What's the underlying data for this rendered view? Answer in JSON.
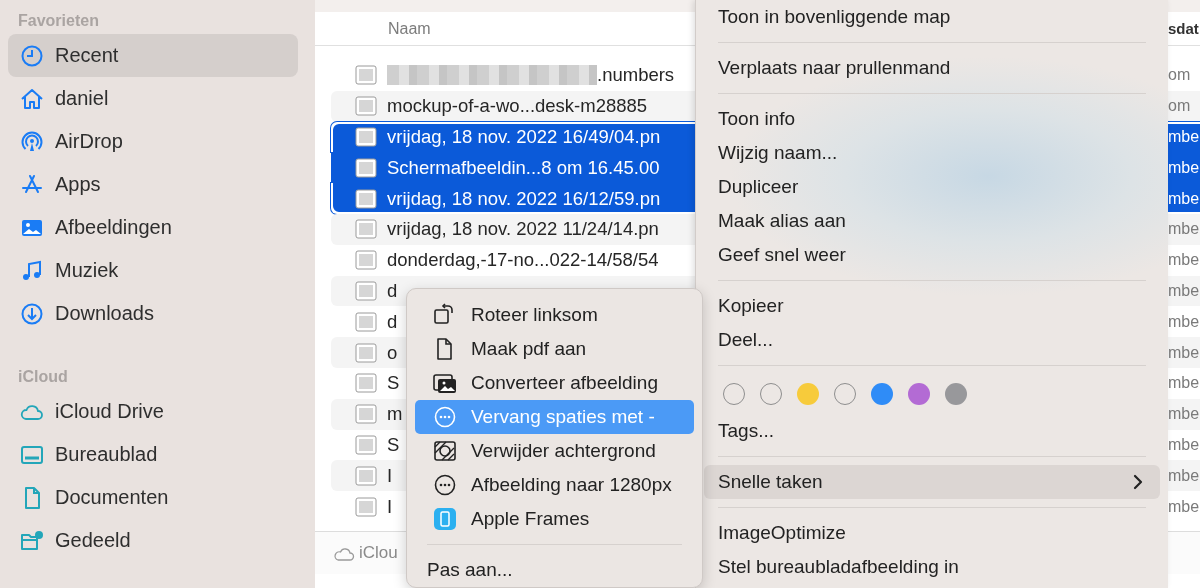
{
  "sidebar": {
    "sections": [
      {
        "title": "Favorieten",
        "items": [
          {
            "label": "Recent",
            "selected": true
          },
          {
            "label": "daniel",
            "selected": false
          },
          {
            "label": "AirDrop",
            "selected": false
          },
          {
            "label": "Apps",
            "selected": false
          },
          {
            "label": "Afbeeldingen",
            "selected": false
          },
          {
            "label": "Muziek",
            "selected": false
          },
          {
            "label": "Downloads",
            "selected": false
          }
        ]
      },
      {
        "title": "iCloud",
        "items": [
          {
            "label": "iCloud Drive",
            "selected": false
          },
          {
            "label": "Bureaublad",
            "selected": false
          },
          {
            "label": "Documenten",
            "selected": false
          },
          {
            "label": "Gedeeld",
            "selected": false
          }
        ]
      }
    ]
  },
  "table": {
    "columns": [
      {
        "label": "Naam"
      },
      {
        "label": "sdat"
      }
    ],
    "rows": [
      {
        "kind": "blurred",
        "name": ".numbers",
        "column_2": "om",
        "selected": false
      },
      {
        "kind": "plain",
        "name": "mockup-of-a-wo...desk-m28885",
        "column_2": "om",
        "selected": false
      },
      {
        "kind": "plain",
        "name": "vrijdag, 18 nov. 2022 16/49/04.pn",
        "column_2": "mbe",
        "selected": true
      },
      {
        "kind": "plain",
        "name": "Schermafbeeldin...8 om 16.45.00",
        "column_2": "mbe",
        "selected": true
      },
      {
        "kind": "plain",
        "name": "vrijdag, 18 nov. 2022 16/12/59.pn",
        "column_2": "mbe",
        "selected": true
      },
      {
        "kind": "plain",
        "name": "vrijdag, 18 nov. 2022 11/24/14.pn",
        "column_2": "mbe",
        "selected": false
      },
      {
        "kind": "plain",
        "name": "donderdag,-17-no...022-14/58/54",
        "column_2": "mbe",
        "selected": false
      },
      {
        "kind": "plain",
        "name": "d",
        "column_2": "mbe",
        "selected": false
      },
      {
        "kind": "plain",
        "name": "d",
        "column_2": "mbe",
        "selected": false
      },
      {
        "kind": "plain",
        "name": "o",
        "column_2": "mbe",
        "selected": false
      },
      {
        "kind": "plain",
        "name": "S",
        "column_2": "mbe",
        "selected": false
      },
      {
        "kind": "plain",
        "name": "m",
        "column_2": "mbe",
        "selected": false
      },
      {
        "kind": "plain",
        "name": "S",
        "column_2": "mbe",
        "selected": false
      },
      {
        "kind": "plain",
        "name": "I",
        "column_2": "mbe",
        "selected": false
      },
      {
        "kind": "plain",
        "name": "I",
        "column_2": "mbe",
        "selected": false
      }
    ]
  },
  "status_bar": {
    "label": "iClou"
  },
  "context_menu": {
    "items": [
      {
        "kind": "item",
        "label": "Toon in bovenliggende map"
      },
      {
        "kind": "separator"
      },
      {
        "kind": "item",
        "label": "Verplaats naar prullenmand"
      },
      {
        "kind": "separator"
      },
      {
        "kind": "item",
        "label": "Toon info"
      },
      {
        "kind": "item",
        "label": "Wijzig naam..."
      },
      {
        "kind": "item",
        "label": "Dupliceer"
      },
      {
        "kind": "item",
        "label": "Maak alias aan"
      },
      {
        "kind": "item",
        "label": "Geef snel weer"
      },
      {
        "kind": "separator"
      },
      {
        "kind": "item",
        "label": "Kopieer"
      },
      {
        "kind": "item",
        "label": "Deel..."
      },
      {
        "kind": "separator"
      },
      {
        "kind": "tags",
        "tags": [
          {
            "kind": "ring",
            "color": "#8e8e8e"
          },
          {
            "kind": "ring",
            "color": "#8e8e8e"
          },
          {
            "kind": "filled",
            "color": "#f7cb3b"
          },
          {
            "kind": "ring",
            "color": "#8e8e8e"
          },
          {
            "kind": "filled",
            "color": "#2f8cf7"
          },
          {
            "kind": "filled",
            "color": "#b36bd4"
          },
          {
            "kind": "filled",
            "color": "#98989b"
          }
        ]
      },
      {
        "kind": "item",
        "label": "Tags..."
      },
      {
        "kind": "separator"
      },
      {
        "kind": "submenu",
        "label": "Snelle taken",
        "selected": true
      },
      {
        "kind": "separator"
      },
      {
        "kind": "item",
        "label": "ImageOptimize"
      },
      {
        "kind": "item",
        "label": "Stel bureaubladafbeelding in"
      }
    ]
  },
  "submenu": {
    "items": [
      {
        "kind": "item",
        "label": "Roteer linksom",
        "selected": false
      },
      {
        "kind": "item",
        "label": "Maak pdf aan",
        "selected": false
      },
      {
        "kind": "item",
        "label": "Converteer afbeelding",
        "selected": false
      },
      {
        "kind": "item",
        "label": "Vervang spaties met -",
        "selected": true
      },
      {
        "kind": "item",
        "label": "Verwijder achtergrond",
        "selected": false
      },
      {
        "kind": "item",
        "label": "Afbeelding naar 1280px",
        "selected": false
      },
      {
        "kind": "item",
        "label": "Apple Frames",
        "selected": false
      },
      {
        "kind": "separator"
      },
      {
        "kind": "plain",
        "label": "Pas aan...",
        "selected": false
      }
    ]
  }
}
